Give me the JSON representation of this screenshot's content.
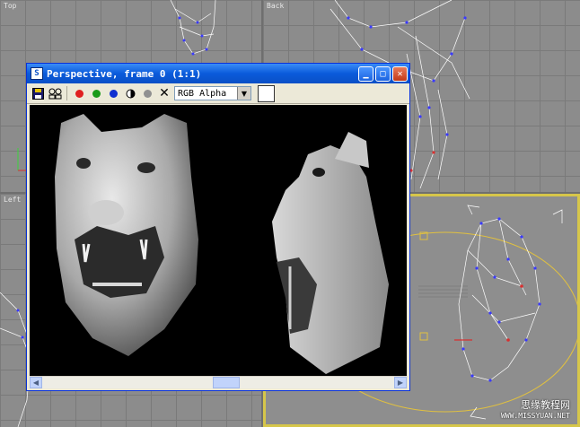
{
  "viewports": {
    "top_label": "Top",
    "back_label": "Back",
    "left_label": "Left"
  },
  "render_window": {
    "title": "Perspective, frame 0 (1:1)",
    "app_icon": "max-logo-icon",
    "controls": {
      "minimize": "minimize-icon",
      "maximize": "maximize-icon",
      "close": "close-icon"
    },
    "toolbar": {
      "channel_selected": "RGB Alpha",
      "colors": {
        "red": "#e02020",
        "green": "#1a9a1a",
        "blue": "#1030d0"
      }
    }
  },
  "watermark": {
    "line1": "思缘教程网",
    "line2": "WWW.MISSYUAN.NET"
  }
}
